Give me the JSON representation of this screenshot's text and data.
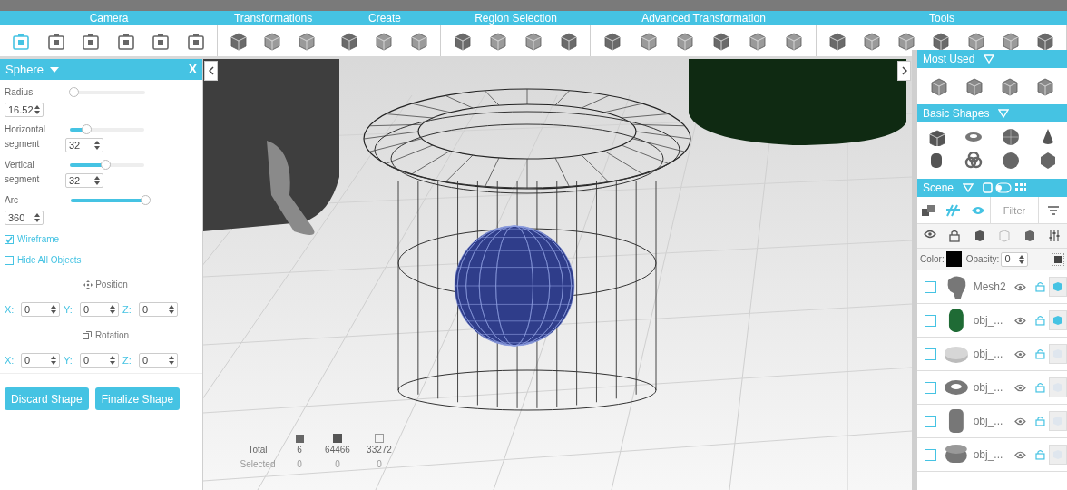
{
  "toolbar": {
    "groups": [
      {
        "label": "Camera",
        "tools": [
          {
            "selected": true
          },
          {
            "selected": false
          },
          {
            "selected": false
          },
          {
            "selected": false
          },
          {
            "selected": false
          },
          {
            "selected": false
          }
        ]
      },
      {
        "label": "Transformations",
        "tools": [
          {
            "selected": false
          },
          {
            "selected": false
          },
          {
            "selected": false
          }
        ]
      },
      {
        "label": "Create",
        "tools": [
          {
            "selected": false
          },
          {
            "selected": false
          },
          {
            "selected": false
          }
        ]
      },
      {
        "label": "Region Selection",
        "tools": [
          {
            "selected": false
          },
          {
            "selected": false
          },
          {
            "selected": false
          },
          {
            "selected": false
          }
        ]
      },
      {
        "label": "Advanced Transformation",
        "tools": [
          {
            "selected": false
          },
          {
            "selected": false
          },
          {
            "selected": false
          },
          {
            "selected": false
          },
          {
            "selected": false
          },
          {
            "selected": false
          }
        ]
      },
      {
        "label": "Tools",
        "tools": [
          {
            "selected": false
          },
          {
            "selected": false
          },
          {
            "selected": false
          },
          {
            "selected": false
          },
          {
            "selected": false
          },
          {
            "selected": false
          },
          {
            "selected": false
          }
        ]
      }
    ]
  },
  "shape_panel": {
    "title": "Sphere",
    "close": "X",
    "params": [
      {
        "kind": "stacked",
        "label": "Radius",
        "level": 0.04,
        "value": "16.52"
      },
      {
        "kind": "inline",
        "label": "Horizontal segment",
        "level": 0.22,
        "value": "32"
      },
      {
        "kind": "inline",
        "label": "Vertical segment",
        "level": 0.47,
        "value": "32"
      },
      {
        "kind": "stacked",
        "label": "Arc",
        "level": 1.0,
        "value": "360"
      }
    ],
    "options": [
      {
        "label": "Wireframe",
        "checked": true
      },
      {
        "label": "Hide All Objects",
        "checked": false
      }
    ],
    "position": {
      "title": "Position",
      "fields": [
        {
          "axis": "X:",
          "value": "0"
        },
        {
          "axis": "Y:",
          "value": "0"
        },
        {
          "axis": "Z:",
          "value": "0"
        }
      ]
    },
    "rotation": {
      "title": "Rotation",
      "fields": [
        {
          "axis": "X:",
          "value": "0"
        },
        {
          "axis": "Y:",
          "value": "0"
        },
        {
          "axis": "Z:",
          "value": "0"
        }
      ]
    },
    "buttons": [
      "Discard Shape",
      "Finalize Shape"
    ]
  },
  "stats": {
    "rows": [
      {
        "kind": "total",
        "label": "Total",
        "values": [
          "6",
          "64466",
          "33272"
        ]
      },
      {
        "kind": "selected",
        "label": "Selected",
        "values": [
          "0",
          "0",
          "0"
        ]
      }
    ]
  },
  "most_used": {
    "title": "Most Used"
  },
  "basic_shapes": {
    "title": "Basic Shapes"
  },
  "scene": {
    "title": "Scene",
    "filter_placeholder": "Filter",
    "color_label": "Color:",
    "opacity_label": "Opacity:",
    "opacity": "0",
    "objects": [
      {
        "kind": "mesh",
        "name": "Mesh2",
        "checked": false,
        "highlighted": true
      },
      {
        "kind": "green-cylinder",
        "name": "obj_...",
        "checked": false,
        "highlighted": true
      },
      {
        "kind": "disc",
        "name": "obj_...",
        "checked": false,
        "highlighted": false
      },
      {
        "kind": "torus",
        "name": "obj_...",
        "checked": false,
        "highlighted": false
      },
      {
        "kind": "cylinder",
        "name": "obj_...",
        "checked": false,
        "highlighted": false
      },
      {
        "kind": "drum",
        "name": "obj_...",
        "checked": false,
        "highlighted": false
      }
    ]
  }
}
